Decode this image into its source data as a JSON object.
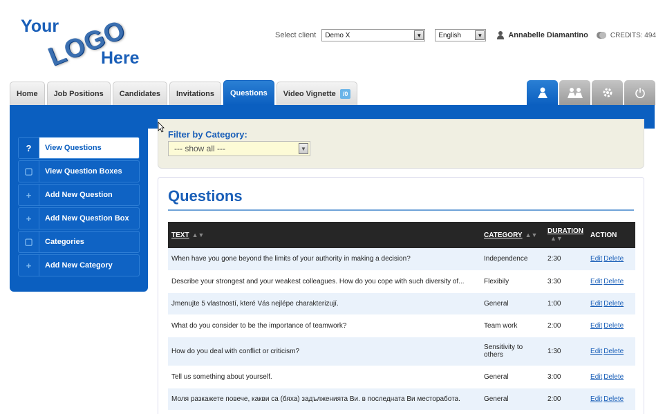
{
  "logo": {
    "line1": "Your",
    "line2": "LOGO",
    "line3": "Here"
  },
  "header": {
    "select_client_label": "Select client",
    "client_value": "Demo X",
    "language_value": "English",
    "user_name": "Annabelle Diamantino",
    "credits": "CREDITS: 494"
  },
  "tabs": [
    {
      "label": "Home"
    },
    {
      "label": "Job Positions"
    },
    {
      "label": "Candidates"
    },
    {
      "label": "Invitations"
    },
    {
      "label": "Questions"
    },
    {
      "label": "Video Vignette",
      "badge": "/0"
    }
  ],
  "icon_tabs": [
    "user-icon",
    "group-icon",
    "gear-icon",
    "power-icon"
  ],
  "sidebar": {
    "items": [
      {
        "label": "View Questions",
        "icon": "?"
      },
      {
        "label": "View Question Boxes",
        "icon": "▢"
      },
      {
        "label": "Add New Question",
        "icon": "+"
      },
      {
        "label": "Add New Question Box",
        "icon": "+"
      },
      {
        "label": "Categories",
        "icon": "▢"
      },
      {
        "label": "Add New Category",
        "icon": "+"
      }
    ]
  },
  "filter": {
    "label": "Filter by Category:",
    "value": "--- show all ---"
  },
  "main": {
    "title": "Questions",
    "columns": {
      "text": "TEXT",
      "category": "CATEGORY",
      "duration": "DURATION",
      "action": "ACTION"
    },
    "edit_label": "Edit",
    "delete_label": "Delete",
    "rows": [
      {
        "text": "When have you gone beyond the limits of your authority in making a decision?",
        "category": "Independence",
        "duration": "2:30"
      },
      {
        "text": "Describe your strongest and your weakest colleagues. How do you cope with such diversity of...",
        "category": "Flexibily",
        "duration": "3:30"
      },
      {
        "text": "Jmenujte 5 vlastností, které Vás nejlépe charakterizují.",
        "category": "General",
        "duration": "1:00"
      },
      {
        "text": "What do you consider to be the importance of teamwork?",
        "category": "Team work",
        "duration": "2:00"
      },
      {
        "text": "How do you deal with conflict or criticism?",
        "category": "Sensitivity to others",
        "duration": "1:30"
      },
      {
        "text": "Tell us something about yourself.",
        "category": "General",
        "duration": "3:00"
      },
      {
        "text": "Моля разкажете повече, какви са (бяха) задълженията Ви. в последната Ви месторабота.",
        "category": "General",
        "duration": "2:00"
      }
    ]
  }
}
